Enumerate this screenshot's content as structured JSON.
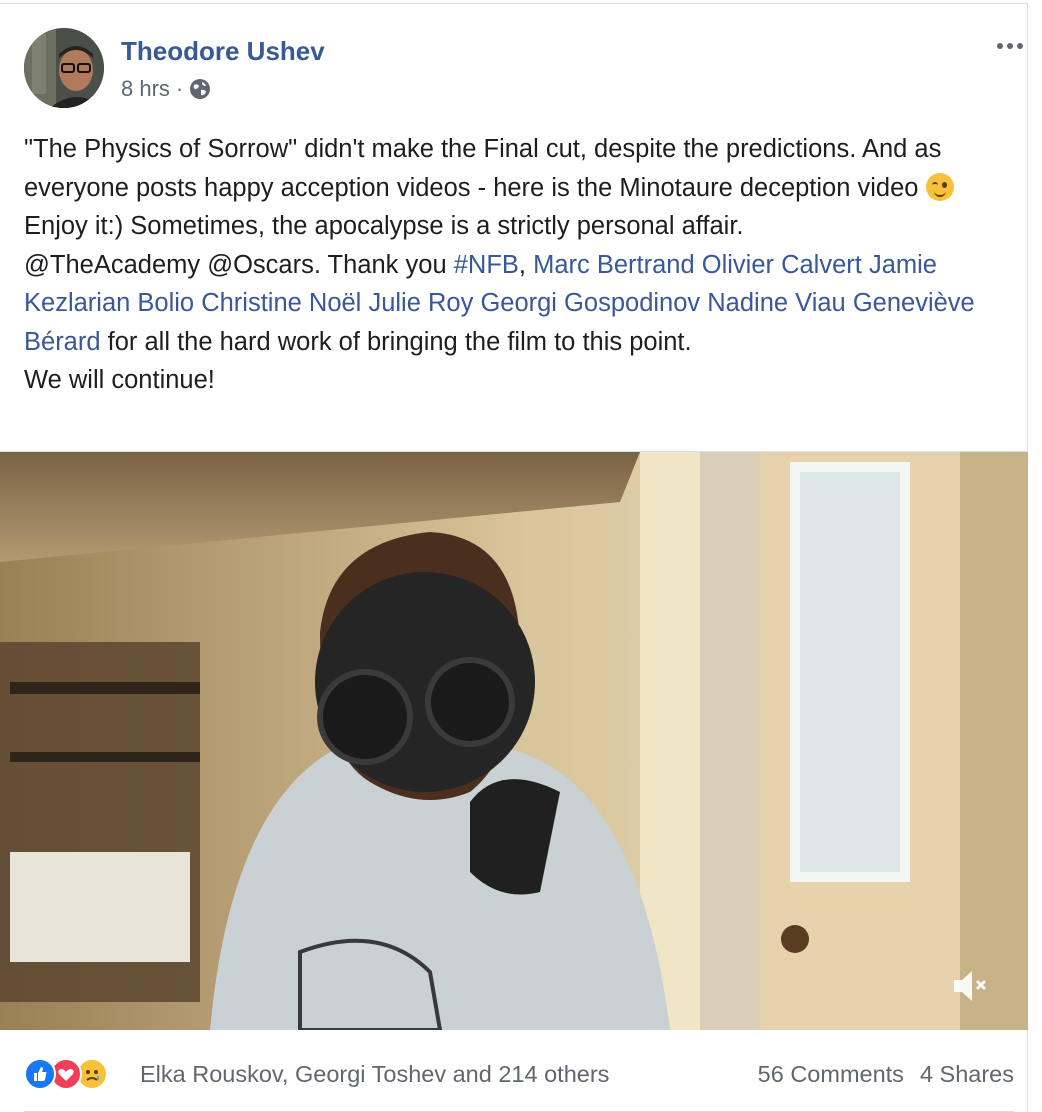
{
  "post": {
    "author": "Theodore Ushev",
    "time": "8 hrs",
    "meta_sep": "·",
    "privacy_icon": "globe-icon",
    "more_icon": "more-options-icon",
    "text": {
      "p1": "\"The Physics of Sorrow\" didn't make the Final cut, despite the predictions. And as everyone posts happy acception videos - here is the Minotaure deception video ",
      "emoji": "winking-face-emoji",
      "p1_end": " Enjoy it:) Sometimes, the apocalypse is a strictly personal affair.",
      "p2_start": "@TheAcademy @Oscars. Thank you ",
      "hashtag": "#NFB",
      "comma": ", ",
      "tags": [
        "Marc Bertrand",
        "Olivier Calvert",
        "Jamie Kezlarian Bolio",
        "Christine Noël",
        "Julie Roy",
        "Georgi Gospodinov",
        "Nadine Viau",
        "Geneviève Bérard"
      ],
      "p2_end": " for all the hard work of bringing the film to this point.",
      "p3": "We will continue!"
    }
  },
  "video": {
    "muted": true,
    "mute_icon": "speaker-muted-icon"
  },
  "footer": {
    "reactions": [
      "like",
      "love",
      "sad"
    ],
    "reaction_names": "Elka Rouskov, Georgi Toshev and 214 others",
    "comments": "56 Comments",
    "shares": "4 Shares"
  },
  "colors": {
    "link": "#385898",
    "meta": "#606770",
    "like": "#1877f2",
    "love": "#f33e58"
  }
}
